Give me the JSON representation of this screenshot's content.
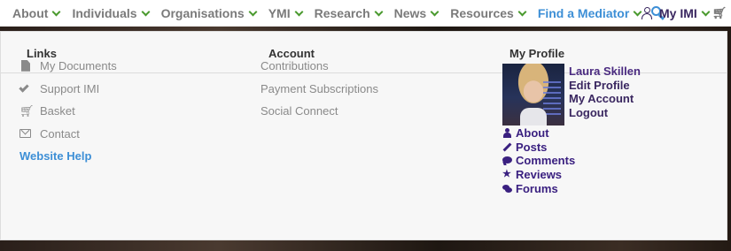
{
  "nav": {
    "items": [
      {
        "label": "About",
        "has_dropdown": true
      },
      {
        "label": "Individuals",
        "has_dropdown": true
      },
      {
        "label": "Organisations",
        "has_dropdown": true
      },
      {
        "label": "YMI",
        "has_dropdown": true
      },
      {
        "label": "Research",
        "has_dropdown": true
      },
      {
        "label": "News",
        "has_dropdown": true
      },
      {
        "label": "Resources",
        "has_dropdown": true
      },
      {
        "label": "Find a Mediator",
        "has_dropdown": true,
        "active": true
      }
    ],
    "search_icon": "search-icon",
    "my_imi_label": "My IMI",
    "cart_icon": "cart-icon"
  },
  "dropdown": {
    "columns": {
      "links_title": "Links",
      "account_title": "Account",
      "profile_title": "My Profile"
    },
    "links": [
      {
        "label": "My Documents",
        "icon": "document-icon"
      },
      {
        "label": "Support IMI",
        "icon": "check-icon"
      },
      {
        "label": "Basket",
        "icon": "cart-icon"
      },
      {
        "label": "Contact",
        "icon": "envelope-icon"
      },
      {
        "label": "Website Help",
        "icon": null
      }
    ],
    "account": [
      {
        "label": "Contributions"
      },
      {
        "label": "Payment Subscriptions"
      },
      {
        "label": "Social Connect"
      }
    ],
    "profile": {
      "name": "Laura Skillen",
      "edit_profile": "Edit Profile",
      "my_account": "My Account",
      "logout": "Logout",
      "nav": [
        {
          "label": "About",
          "icon": "user-icon"
        },
        {
          "label": "Posts",
          "icon": "pencil-icon"
        },
        {
          "label": "Comments",
          "icon": "comment-icon"
        },
        {
          "label": "Reviews",
          "icon": "star-icon"
        },
        {
          "label": "Forums",
          "icon": "comments-icon"
        }
      ]
    }
  },
  "colors": {
    "nav_text": "#7a7a7a",
    "nav_active": "#3d8fd6",
    "chevron": "#4a9a2e",
    "profile_purple": "#3a2080",
    "panel_bg": "#f7f7f7"
  }
}
